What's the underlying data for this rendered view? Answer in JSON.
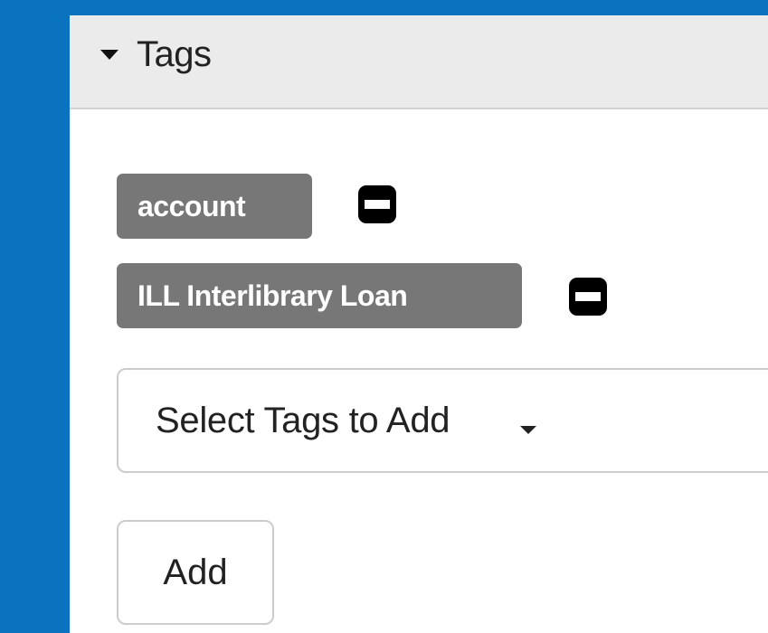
{
  "panel": {
    "title": "Tags",
    "toggle_icon": "caret-down-icon"
  },
  "tags": [
    {
      "label": "account",
      "remove_icon": "minus-square-icon"
    },
    {
      "label": "ILL Interlibrary Loan",
      "remove_icon": "minus-square-icon"
    }
  ],
  "select": {
    "label": "Select Tags to Add",
    "icon": "caret-down-icon"
  },
  "add_button": {
    "label": "Add"
  },
  "colors": {
    "page_background": "#0a73bf",
    "panel_header": "#ebebeb",
    "tag_background": "#777777",
    "remove_button": "#000000"
  }
}
